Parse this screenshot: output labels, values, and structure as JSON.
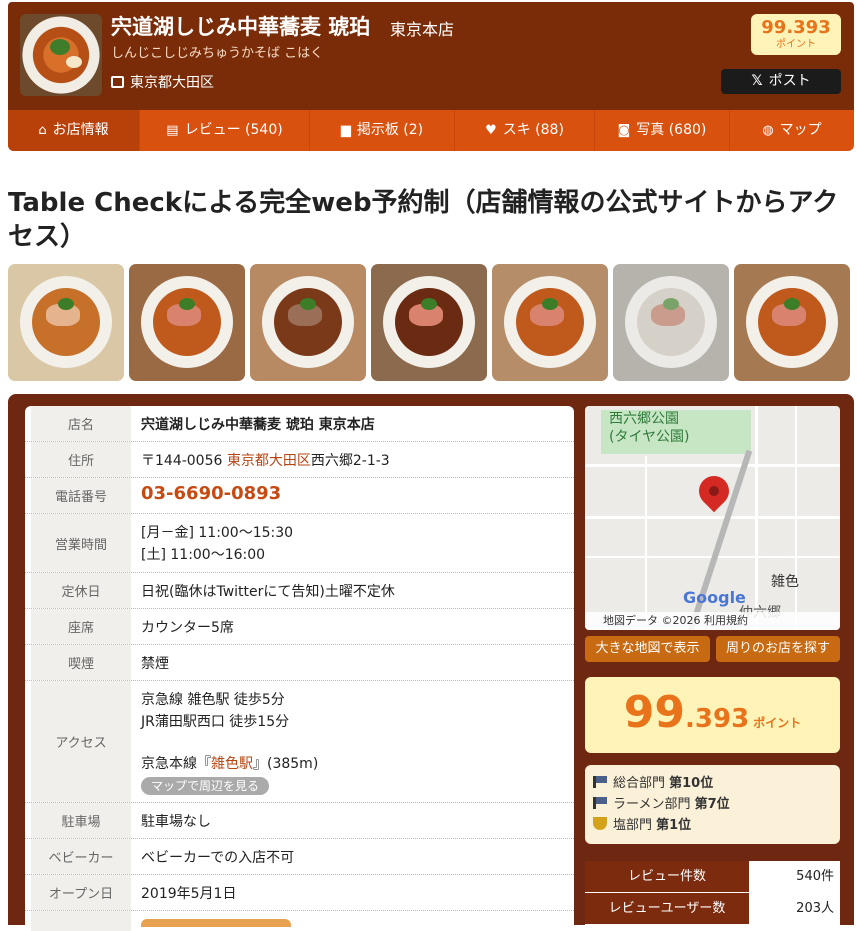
{
  "header": {
    "shop_name": "宍道湖しじみ中華蕎麦 琥珀",
    "branch": "東京本店",
    "kana": "しんじこしじみちゅうかそば こはく",
    "location": "東京都大田区",
    "points": "99.393",
    "points_label": "ポイント",
    "x_post": "ポスト"
  },
  "nav": [
    {
      "label": "お店情報",
      "icon": "home-icon"
    },
    {
      "label": "レビュー (540)",
      "icon": "clipboard-icon"
    },
    {
      "label": "掲示板 (2)",
      "icon": "chat-icon"
    },
    {
      "label": "スキ (88)",
      "icon": "heart-icon"
    },
    {
      "label": "写真 (680)",
      "icon": "camera-icon"
    },
    {
      "label": "マップ",
      "icon": "globe-icon"
    }
  ],
  "title": "Table Checkによる完全web予約制（店舗情報の公式サイトからアクセス）",
  "info": {
    "name_label": "店名",
    "name": "宍道湖しじみ中華蕎麦 琥珀 東京本店",
    "address_label": "住所",
    "postal": "〒144-0056",
    "address_link": "東京都大田区",
    "address_rest": "西六郷2-1-3",
    "phone_label": "電話番号",
    "phone": "03-6690-0893",
    "hours_label": "営業時間",
    "hours1": "[月－金] 11:00～15:30",
    "hours2": "[土] 11:00～16:00",
    "closed_label": "定休日",
    "closed": "日祝(臨休はTwitterにて告知)土曜不定休",
    "seats_label": "座席",
    "seats": "カウンター5席",
    "smoking_label": "喫煙",
    "smoking": "禁煙",
    "access_label": "アクセス",
    "access1": "京急線 雑色駅 徒歩5分",
    "access2": "JR蒲田駅西口 徒歩15分",
    "access3_pre": "京急本線『",
    "access3_link": "雑色駅",
    "access3_post": "』(385m)",
    "map_pill": "マップで周辺を見る",
    "parking_label": "駐車場",
    "parking": "駐車場なし",
    "baby_label": "ベビーカー",
    "baby": "ベビーカーでの入店不可",
    "open_label": "オープン日",
    "open": "2019年5月1日"
  },
  "map": {
    "park": "西六郷公園\n(タイヤ公園)",
    "station": "雑色",
    "area": "仲六郷",
    "google": "Google",
    "footer": "地図データ ©2026   利用規約",
    "btn_large": "大きな地図で表示",
    "btn_nearby": "周りのお店を探す"
  },
  "score": {
    "int": "99",
    "dec": ".393",
    "unit": "ポイント"
  },
  "ranks": [
    {
      "pre": "総合部門 ",
      "rank": "第10位",
      "icon": "flag-icon"
    },
    {
      "pre": "ラーメン部門 ",
      "rank": "第7位",
      "icon": "flag-icon"
    },
    {
      "pre": "塩部門 ",
      "rank": "第1位",
      "icon": "trophy-icon"
    }
  ],
  "stats": [
    {
      "k": "レビュー件数",
      "v": "540件"
    },
    {
      "k": "レビューユーザー数",
      "v": "203人"
    }
  ]
}
